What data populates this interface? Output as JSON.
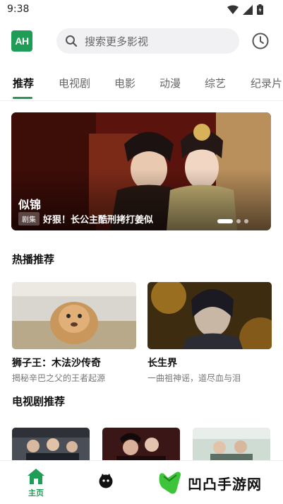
{
  "status": {
    "time": "9:38"
  },
  "header": {
    "logo_text": "AH",
    "search_placeholder": "搜索更多影视"
  },
  "tabs": [
    {
      "label": "推荐",
      "active": true
    },
    {
      "label": "电视剧"
    },
    {
      "label": "电影"
    },
    {
      "label": "动漫"
    },
    {
      "label": "综艺"
    },
    {
      "label": "纪录片"
    }
  ],
  "banner": {
    "title": "似锦",
    "badge": "剧集",
    "subtitle": "好狠！长公主酷刑拷打姜似",
    "slide_count": 3,
    "active_slide": 1
  },
  "hot_section": {
    "title": "热播推荐",
    "items": [
      {
        "title": "狮子王：木法沙传奇",
        "desc": "揭秘辛巴之父的王者起源"
      },
      {
        "title": "长生界",
        "desc": "一曲祖神谣，道尽血与泪"
      }
    ]
  },
  "drama_section": {
    "title": "电视剧推荐"
  },
  "bottom_nav": {
    "home_label": "主页"
  },
  "watermark": {
    "text": "凹凸手游网"
  },
  "colors": {
    "accent": "#1f9d57"
  }
}
